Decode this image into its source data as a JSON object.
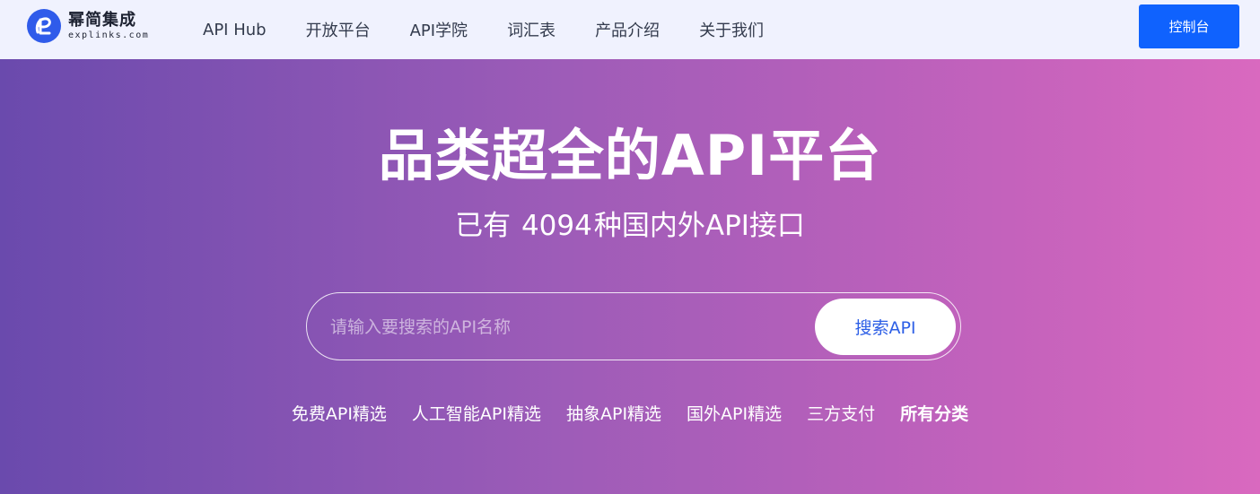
{
  "logo": {
    "name": "幂简集成",
    "domain": "explinks.com",
    "glyph": "e"
  },
  "nav": {
    "items": [
      "API Hub",
      "开放平台",
      "API学院",
      "词汇表",
      "产品介绍",
      "关于我们"
    ],
    "console_label": "控制台"
  },
  "hero": {
    "title": "品类超全的API平台",
    "subtitle_prefix": "已有",
    "count": "4094",
    "subtitle_suffix": "种国内外API接口"
  },
  "search": {
    "placeholder": "请输入要搜索的API名称",
    "value": "",
    "button_label": "搜索API"
  },
  "categories": [
    "免费API精选",
    "人工智能API精选",
    "抽象API精选",
    "国外API精选",
    "三方支付",
    "所有分类"
  ],
  "colors": {
    "primary": "#0f62fe",
    "navbar_bg": "#f0f2fe",
    "hero_gradient_start": "#6a4aad",
    "hero_gradient_end": "#d969bf"
  }
}
